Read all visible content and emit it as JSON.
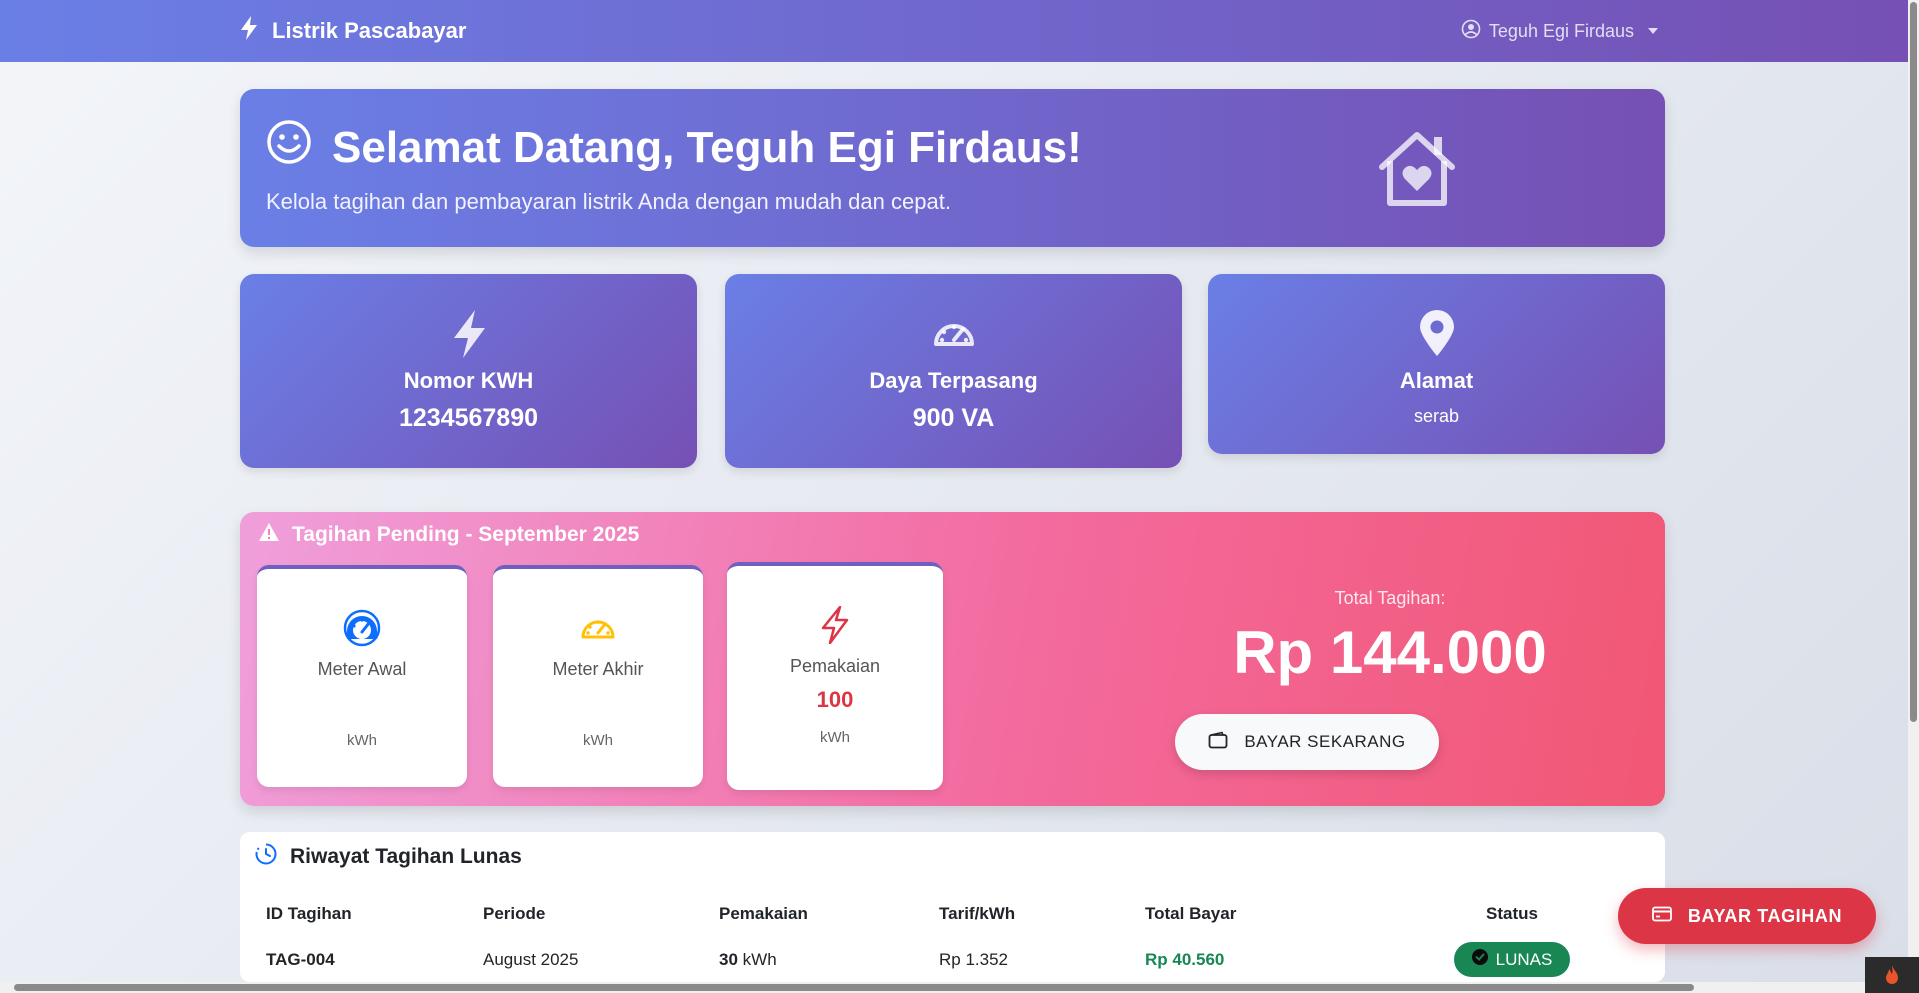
{
  "navbar": {
    "brand": "Listrik Pascabayar",
    "user_name": "Teguh Egi Firdaus"
  },
  "welcome": {
    "title": "Selamat Datang, Teguh Egi Firdaus!",
    "subtitle": "Kelola tagihan dan pembayaran listrik Anda dengan mudah dan cepat."
  },
  "info_cards": [
    {
      "label": "Nomor KWH",
      "value": "1234567890",
      "icon": "bolt-icon"
    },
    {
      "label": "Daya Terpasang",
      "value": "900 VA",
      "icon": "speedometer-icon"
    },
    {
      "label": "Alamat",
      "value": "serab",
      "icon": "location-pin-icon"
    }
  ],
  "pending": {
    "title": "Tagihan Pending - September 2025",
    "meters": [
      {
        "label": "Meter Awal",
        "value": "",
        "unit": "kWh",
        "icon": "speedometer-icon",
        "color": "#0d6efd"
      },
      {
        "label": "Meter Akhir",
        "value": "",
        "unit": "kWh",
        "icon": "speedometer-icon",
        "color": "#ffc107"
      },
      {
        "label": "Pemakaian",
        "value": "100",
        "unit": "kWh",
        "icon": "bolt-icon",
        "color": "#dc3545"
      }
    ],
    "total_label": "Total Tagihan:",
    "total_value": "Rp 144.000",
    "pay_button": "BAYAR SEKARANG"
  },
  "history": {
    "title": "Riwayat Tagihan Lunas",
    "columns": [
      "ID Tagihan",
      "Periode",
      "Pemakaian",
      "Tarif/kWh",
      "Total Bayar",
      "Status"
    ],
    "rows": [
      {
        "id": "TAG-004",
        "periode": "August 2025",
        "pemakaian_value": "30",
        "pemakaian_unit": "kWh",
        "tarif": "Rp 1.352",
        "total": "Rp 40.560",
        "status": "LUNAS"
      }
    ]
  },
  "floating_button": "BAYAR TAGIHAN",
  "colors": {
    "primary_gradient_start": "#6a7fe6",
    "primary_gradient_end": "#7650b4",
    "danger": "#dc3545",
    "success": "#198754"
  }
}
